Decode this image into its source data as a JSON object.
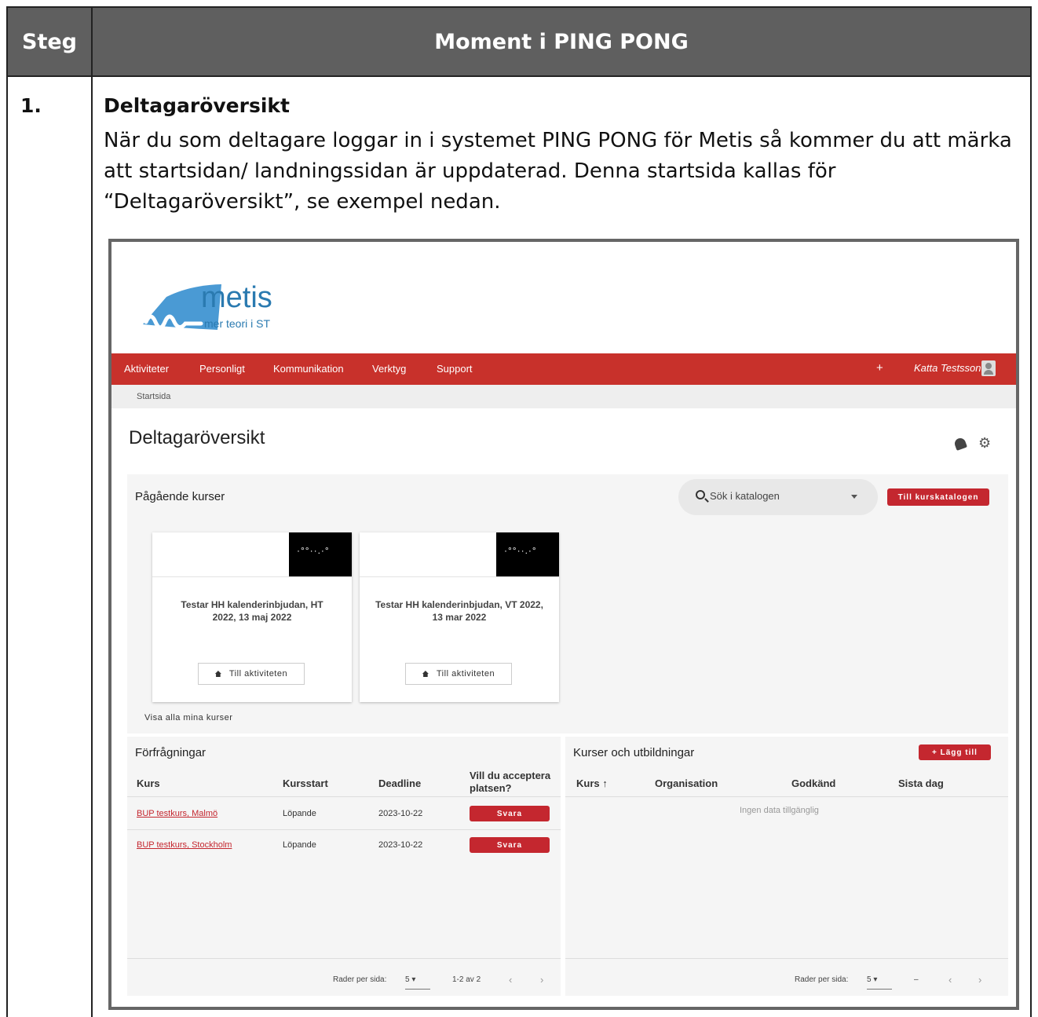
{
  "doc": {
    "header_step": "Steg",
    "header_moment": "Moment i PING PONG",
    "step_number": "1.",
    "step_title": "Deltagaröversikt",
    "step_text": "När du som deltagare loggar in i systemet PING PONG för Metis så kommer du att märka att startsidan/ landningssidan är uppdaterad. Denna startsida kallas för “Deltagaröversikt”, se exempel nedan."
  },
  "app": {
    "logo_text": "metis",
    "logo_sub": "mer teori i ST",
    "nav": [
      "Aktiviteter",
      "Personligt",
      "Kommunikation",
      "Verktyg",
      "Support"
    ],
    "nav_plus": "+",
    "user_name": "Katta Testsson",
    "breadcrumb": "Startsida",
    "page_title": "Deltagaröversikt",
    "courses": {
      "title": "Pågående kurser",
      "search_placeholder": "Sök i katalogen",
      "catalog_button": "Till kurskatalogen",
      "cards": [
        {
          "title": "Testar HH kalenderinbjudan, HT 2022, 13 maj 2022",
          "button": "Till aktiviteten"
        },
        {
          "title": "Testar HH kalenderinbjudan, VT 2022, 13 mar 2022",
          "button": "Till aktiviteten"
        }
      ],
      "show_all": "Visa alla mina kurser"
    },
    "requests": {
      "title": "Förfrågningar",
      "columns": [
        "Kurs",
        "Kursstart",
        "Deadline",
        "Vill du acceptera platsen?"
      ],
      "rows": [
        {
          "kurs": "BUP testkurs, Malmö",
          "start": "Löpande",
          "deadline": "2023-10-22",
          "action": "Svara"
        },
        {
          "kurs": "BUP testkurs, Stockholm",
          "start": "Löpande",
          "deadline": "2023-10-22",
          "action": "Svara"
        }
      ],
      "rows_per_page_label": "Rader per sida:",
      "rows_per_page": "5",
      "range": "1-2 av 2"
    },
    "training": {
      "title": "Kurser och utbildningar",
      "add_button": "+ Lägg till",
      "columns": [
        "Kurs ↑",
        "Organisation",
        "Godkänd",
        "Sista dag"
      ],
      "empty": "Ingen data tillgänglig",
      "rows_per_page_label": "Rader per sida:",
      "rows_per_page": "5",
      "range": "–"
    }
  }
}
